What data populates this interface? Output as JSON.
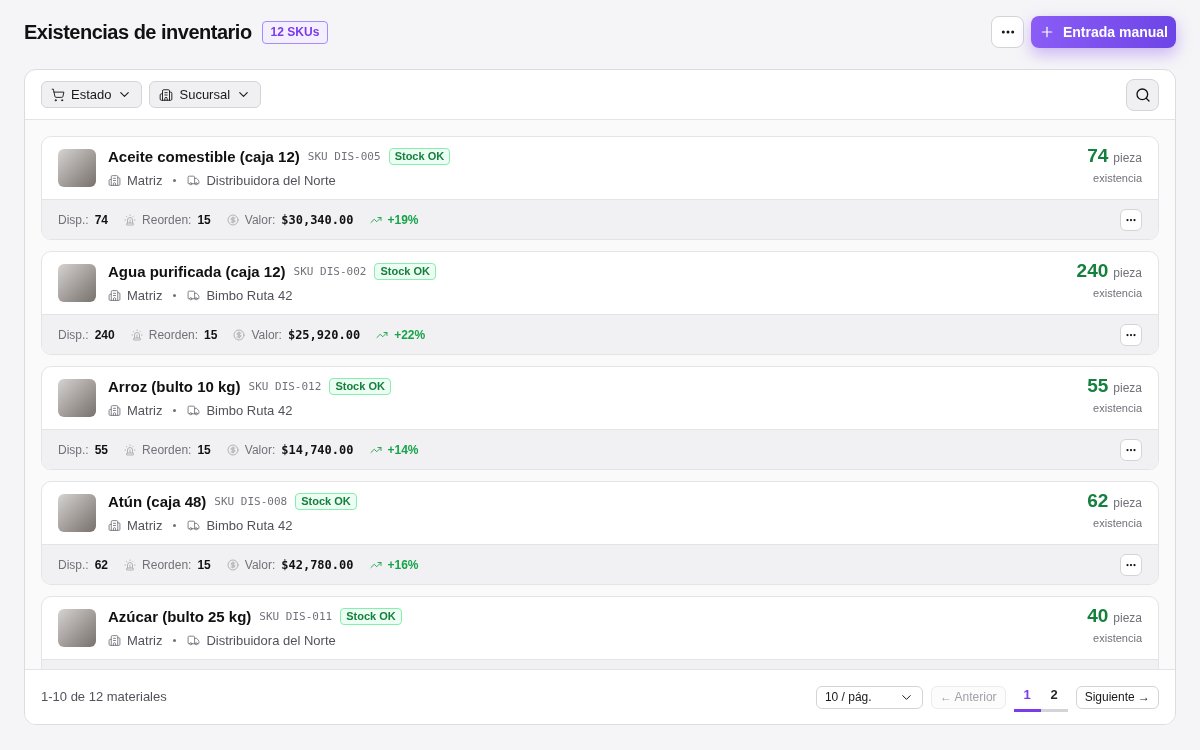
{
  "header": {
    "title": "Existencias de inventario",
    "count_badge": "12 SKUs",
    "primary_button": "Entrada manual"
  },
  "toolbar": {
    "filters": [
      "Estado",
      "Sucursal"
    ]
  },
  "items": [
    {
      "name": "Aceite comestible (caja 12)",
      "sku": "SKU DIS-005",
      "status": "Stock OK",
      "branch": "Matriz",
      "supplier": "Distribuidora del Norte",
      "quantity": "74",
      "unit": "pieza",
      "quantity_label": "existencia",
      "stats": {
        "available_label": "Disp.:",
        "available": "74",
        "reorder_label": "Reorden:",
        "reorder": "15",
        "value_label": "Valor:",
        "value": "$30,340.00",
        "trend": "+19%"
      }
    },
    {
      "name": "Agua purificada (caja 12)",
      "sku": "SKU DIS-002",
      "status": "Stock OK",
      "branch": "Matriz",
      "supplier": "Bimbo Ruta 42",
      "quantity": "240",
      "unit": "pieza",
      "quantity_label": "existencia",
      "stats": {
        "available_label": "Disp.:",
        "available": "240",
        "reorder_label": "Reorden:",
        "reorder": "15",
        "value_label": "Valor:",
        "value": "$25,920.00",
        "trend": "+22%"
      }
    },
    {
      "name": "Arroz (bulto 10 kg)",
      "sku": "SKU DIS-012",
      "status": "Stock OK",
      "branch": "Matriz",
      "supplier": "Bimbo Ruta 42",
      "quantity": "55",
      "unit": "pieza",
      "quantity_label": "existencia",
      "stats": {
        "available_label": "Disp.:",
        "available": "55",
        "reorder_label": "Reorden:",
        "reorder": "15",
        "value_label": "Valor:",
        "value": "$14,740.00",
        "trend": "+14%"
      }
    },
    {
      "name": "Atún (caja 48)",
      "sku": "SKU DIS-008",
      "status": "Stock OK",
      "branch": "Matriz",
      "supplier": "Bimbo Ruta 42",
      "quantity": "62",
      "unit": "pieza",
      "quantity_label": "existencia",
      "stats": {
        "available_label": "Disp.:",
        "available": "62",
        "reorder_label": "Reorden:",
        "reorder": "15",
        "value_label": "Valor:",
        "value": "$42,780.00",
        "trend": "+16%"
      }
    },
    {
      "name": "Azúcar (bulto 25 kg)",
      "sku": "SKU DIS-011",
      "status": "Stock OK",
      "branch": "Matriz",
      "supplier": "Distribuidora del Norte",
      "quantity": "40",
      "unit": "pieza",
      "quantity_label": "existencia"
    }
  ],
  "footer": {
    "summary": "1-10 de 12 materiales",
    "page_size": "10 / pág.",
    "previous": {
      "label": "← Anterior",
      "disabled": true
    },
    "pages": [
      {
        "label": "1",
        "selected": true
      },
      {
        "label": "2",
        "selected": false
      }
    ],
    "next": {
      "label": "Siguiente →",
      "disabled": false
    }
  }
}
